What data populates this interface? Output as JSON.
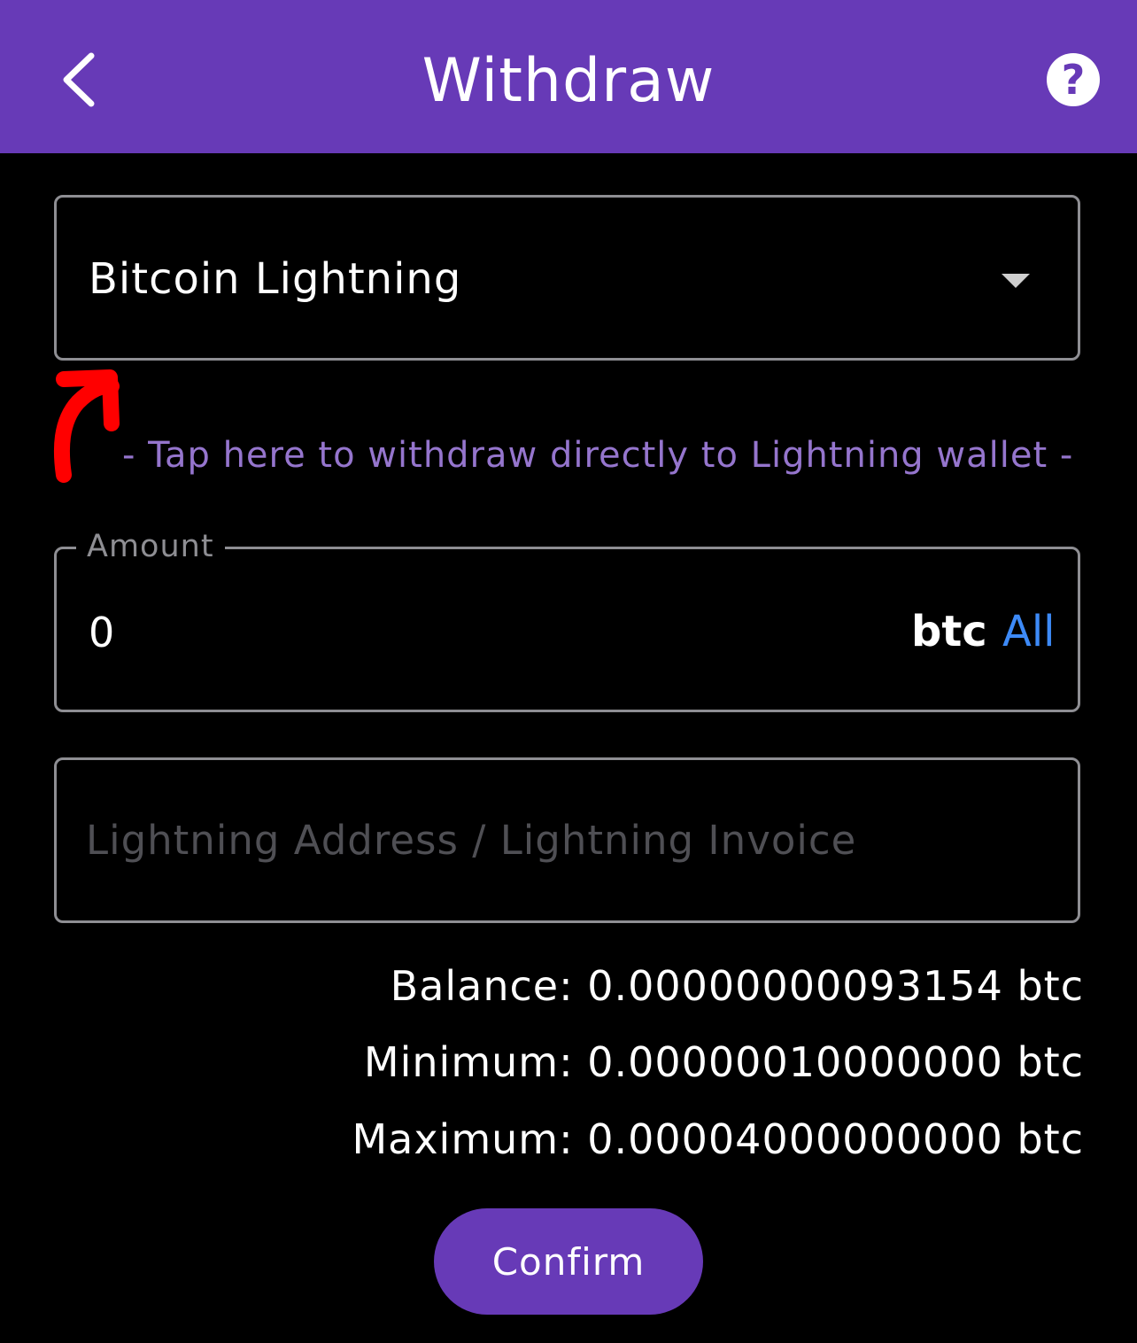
{
  "header": {
    "title": "Withdraw",
    "back_icon": "chevron-left-icon",
    "help_icon": "help-circle-icon"
  },
  "network_select": {
    "selected": "Bitcoin Lightning",
    "caret_icon": "caret-down-icon"
  },
  "hint": {
    "text": "- Tap here to withdraw directly to Lightning wallet -",
    "arrow_icon": "hand-drawn-red-arrow-icon"
  },
  "amount": {
    "label": "Amount",
    "value": "0",
    "unit": "btc",
    "all_label": "All"
  },
  "address": {
    "placeholder": "Lightning Address / Lightning Invoice",
    "value": ""
  },
  "limits": {
    "balance": "Balance: 0.00000000093154 btc",
    "minimum": "Minimum: 0.00000010000000 btc",
    "maximum": "Maximum: 0.00004000000000 btc"
  },
  "confirm_label": "Confirm",
  "colors": {
    "primary": "#673ab7",
    "hint": "#9575cd",
    "link": "#3d8af7",
    "border": "#8e8e93",
    "annotation": "#ff0000"
  }
}
